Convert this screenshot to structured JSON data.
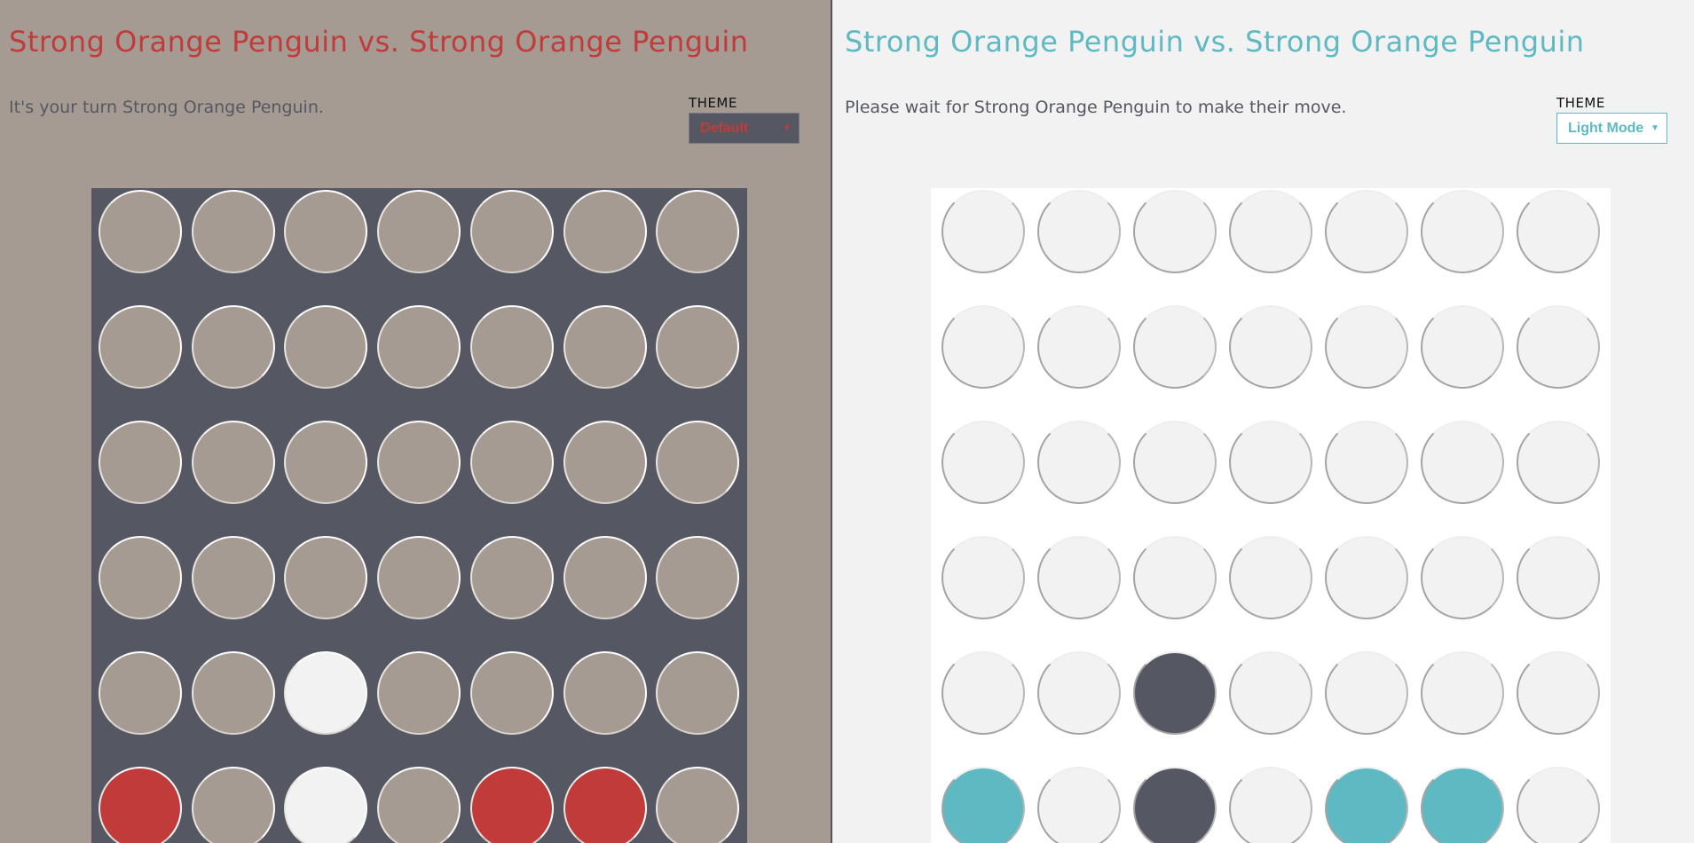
{
  "left_pane": {
    "title": "Strong Orange Penguin vs. Strong Orange Penguin",
    "status": "It's your turn Strong Orange Penguin.",
    "theme_label": "THEME",
    "theme_value": "Default",
    "colors": {
      "background": "#a59b93",
      "board": "#555862",
      "empty": "#a59b93",
      "player1": "#c23b3b",
      "player2": "#f2f2f2",
      "accent": "#c23b3b"
    }
  },
  "right_pane": {
    "title": "Strong Orange Penguin vs. Strong Orange Penguin",
    "status": "Please wait for Strong Orange Penguin to make their move.",
    "theme_label": "THEME",
    "theme_value": "Light Mode",
    "colors": {
      "background": "#f2f2f2",
      "board": "#ffffff",
      "empty": "#f2f2f2",
      "player1": "#5fb9c3",
      "player2": "#555862",
      "accent": "#5fb9c3"
    }
  },
  "board": {
    "rows": 6,
    "columns": 7,
    "cells": [
      [
        0,
        0,
        0,
        0,
        0,
        0,
        0
      ],
      [
        0,
        0,
        0,
        0,
        0,
        0,
        0
      ],
      [
        0,
        0,
        0,
        0,
        0,
        0,
        0
      ],
      [
        0,
        0,
        0,
        0,
        0,
        0,
        0
      ],
      [
        0,
        0,
        2,
        0,
        0,
        0,
        0
      ],
      [
        1,
        0,
        2,
        0,
        1,
        1,
        0
      ]
    ]
  }
}
